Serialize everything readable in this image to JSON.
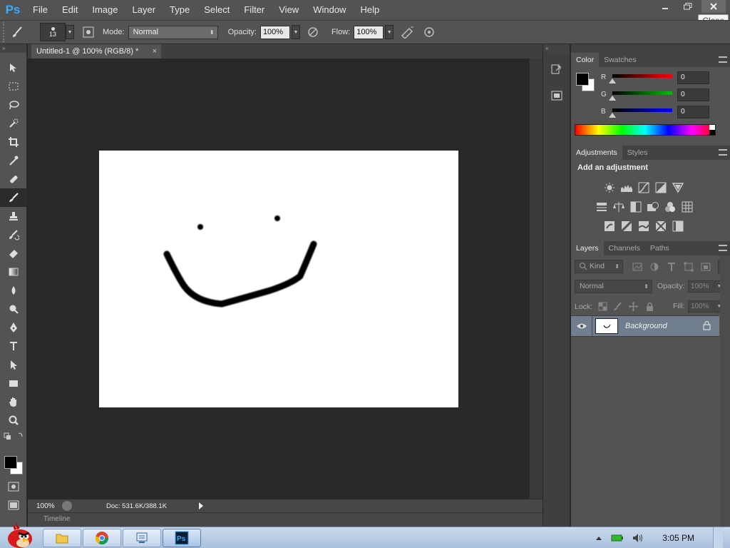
{
  "app": {
    "logo": "Ps",
    "menu": [
      "File",
      "Edit",
      "Image",
      "Layer",
      "Type",
      "Select",
      "Filter",
      "View",
      "Window",
      "Help"
    ],
    "close_tooltip": "Close"
  },
  "options_bar": {
    "brush_size": "13",
    "mode_label": "Mode:",
    "mode_value": "Normal",
    "opacity_label": "Opacity:",
    "opacity_value": "100%",
    "flow_label": "Flow:",
    "flow_value": "100%"
  },
  "document": {
    "tab_title": "Untitled-1 @ 100% (RGB/8) *",
    "zoom": "100%",
    "doc_size": "Doc: 531.6K/388.1K",
    "timeline_label": "Timeline"
  },
  "tools": [
    "move-tool",
    "marquee-tool",
    "lasso-tool",
    "quick-select-tool",
    "crop-tool",
    "eyedropper-tool",
    "healing-brush-tool",
    "brush-tool",
    "clone-stamp-tool",
    "history-brush-tool",
    "eraser-tool",
    "gradient-tool",
    "blur-tool",
    "dodge-tool",
    "pen-tool",
    "type-tool",
    "path-select-tool",
    "rectangle-tool",
    "hand-tool",
    "zoom-tool"
  ],
  "active_tool": "brush-tool",
  "color_panel": {
    "tabs": [
      "Color",
      "Swatches"
    ],
    "channels": [
      {
        "label": "R",
        "value": "0",
        "color": "#ff0000"
      },
      {
        "label": "G",
        "value": "0",
        "color": "#00c000"
      },
      {
        "label": "B",
        "value": "0",
        "color": "#0000ff"
      }
    ]
  },
  "adjustments_panel": {
    "tabs": [
      "Adjustments",
      "Styles"
    ],
    "title": "Add an adjustment"
  },
  "layers_panel": {
    "tabs": [
      "Layers",
      "Channels",
      "Paths"
    ],
    "kind_label": "Kind",
    "blend_mode": "Normal",
    "opacity_label": "Opacity:",
    "opacity_value": "100%",
    "lock_label": "Lock:",
    "fill_label": "Fill:",
    "fill_value": "100%",
    "layers": [
      {
        "name": "Background",
        "visible": true,
        "locked": true
      }
    ]
  },
  "taskbar": {
    "time": "3:05 PM"
  },
  "colors": {
    "accent": "#3fa9f5",
    "panel": "#535353",
    "canvas_bg": "#282828",
    "selected_layer": "#6f7d8f"
  }
}
